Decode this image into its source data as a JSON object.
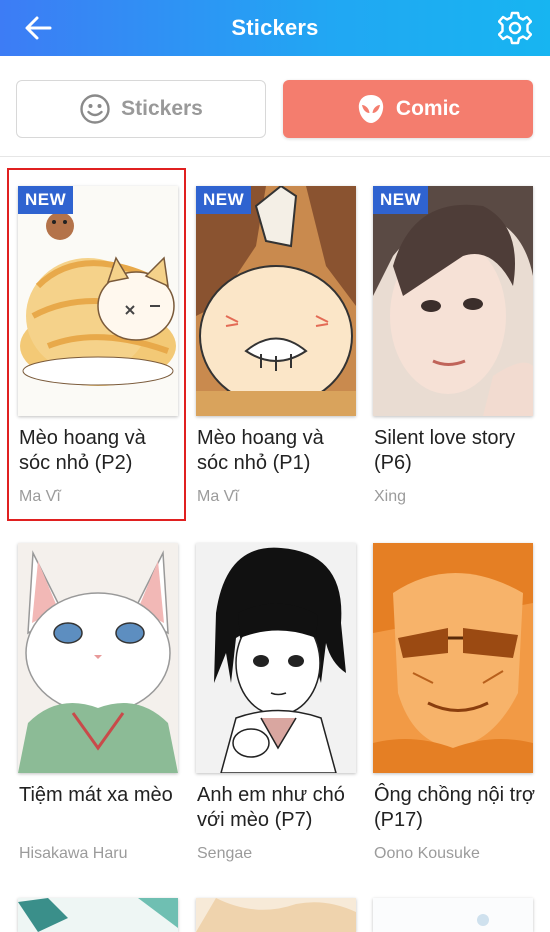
{
  "header": {
    "title": "Stickers",
    "back_icon": "back-arrow-icon",
    "settings_icon": "gear-icon"
  },
  "tabs": [
    {
      "label": "Stickers",
      "icon": "smiley-icon",
      "active": false
    },
    {
      "label": "Comic",
      "icon": "alien-mask-icon",
      "active": true
    }
  ],
  "colors": {
    "header_start": "#3d7cf5",
    "header_end": "#17b5f1",
    "active_tab": "#f47d6e",
    "badge": "#2f63d0",
    "selection_outline": "#e02020"
  },
  "comics": [
    {
      "badge": "NEW",
      "title": "Mèo hoang và sóc nhỏ (P2)",
      "author": "Ma Vĩ",
      "selected": true
    },
    {
      "badge": "NEW",
      "title": "Mèo hoang và sóc nhỏ (P1)",
      "author": "Ma Vĩ",
      "selected": false
    },
    {
      "badge": "NEW",
      "title": "Silent love story (P6)",
      "author": "Xing",
      "selected": false
    },
    {
      "badge": "",
      "title": "Tiệm mát xa mèo",
      "author": "Hisakawa Haru",
      "selected": false
    },
    {
      "badge": "",
      "title": "Anh em như chó với mèo (P7)",
      "author": "Sengae",
      "selected": false
    },
    {
      "badge": "",
      "title": "Ông chồng nội trợ (P17)",
      "author": "Oono Kousuke",
      "selected": false
    }
  ]
}
